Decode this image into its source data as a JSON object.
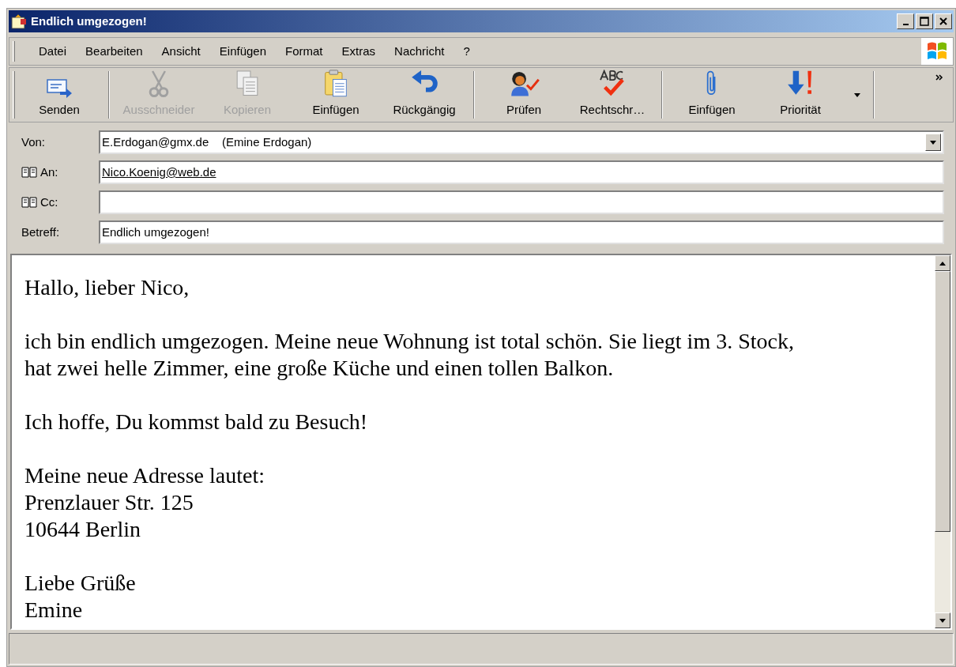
{
  "window": {
    "title": "Endlich umgezogen!"
  },
  "menu": [
    {
      "label": "Datei"
    },
    {
      "label": "Bearbeiten"
    },
    {
      "label": "Ansicht"
    },
    {
      "label": "Einfügen"
    },
    {
      "label": "Format"
    },
    {
      "label": "Extras"
    },
    {
      "label": "Nachricht"
    },
    {
      "label": "?"
    }
  ],
  "toolbar": {
    "groups": [
      {
        "buttons": [
          {
            "kind": "send",
            "label": "Senden",
            "disabled": false,
            "dropdown": false
          }
        ]
      },
      {
        "buttons": [
          {
            "kind": "cut",
            "label": "Ausschneider",
            "disabled": true,
            "dropdown": false
          },
          {
            "kind": "copy",
            "label": "Kopieren",
            "disabled": true,
            "dropdown": false
          },
          {
            "kind": "paste",
            "label": "Einfügen",
            "disabled": false,
            "dropdown": false
          },
          {
            "kind": "undo",
            "label": "Rückgängig",
            "disabled": false,
            "dropdown": false
          }
        ]
      },
      {
        "buttons": [
          {
            "kind": "check",
            "label": "Prüfen",
            "disabled": false,
            "dropdown": false
          },
          {
            "kind": "spell",
            "label": "Rechtschr…",
            "disabled": false,
            "dropdown": false
          }
        ]
      },
      {
        "buttons": [
          {
            "kind": "attach",
            "label": "Einfügen",
            "disabled": false,
            "dropdown": false
          },
          {
            "kind": "priority",
            "label": "Priorität",
            "disabled": false,
            "dropdown": true
          }
        ]
      }
    ]
  },
  "header_fields": [
    {
      "kind": "dropdown",
      "label": "Von:",
      "value": "E.Erdogan@gmx.de    (Emine Erdogan)"
    },
    {
      "kind": "address",
      "label": "An:",
      "value": "Nico.Koenig@web.de"
    },
    {
      "kind": "address",
      "label": "Cc:"
    },
    {
      "kind": "plain",
      "label": "Betreff:",
      "value": "Endlich umgezogen!"
    }
  ],
  "body": {
    "paragraphs": [
      {
        "lines": [
          "Hallo, lieber Nico,"
        ]
      },
      {
        "lines": [
          "ich bin endlich umgezogen. Meine neue Wohnung ist total schön. Sie liegt im 3. Stock,",
          "hat zwei helle Zimmer, eine große Küche und einen tollen Balkon."
        ]
      },
      {
        "lines": [
          "Ich hoffe, Du kommst bald zu Besuch!"
        ]
      },
      {
        "lines": [
          "Meine neue Adresse lautet:",
          "Prenzlauer Str. 125",
          "10644 Berlin"
        ]
      },
      {
        "lines": [
          "Liebe Grüße",
          "Emine"
        ]
      }
    ]
  }
}
